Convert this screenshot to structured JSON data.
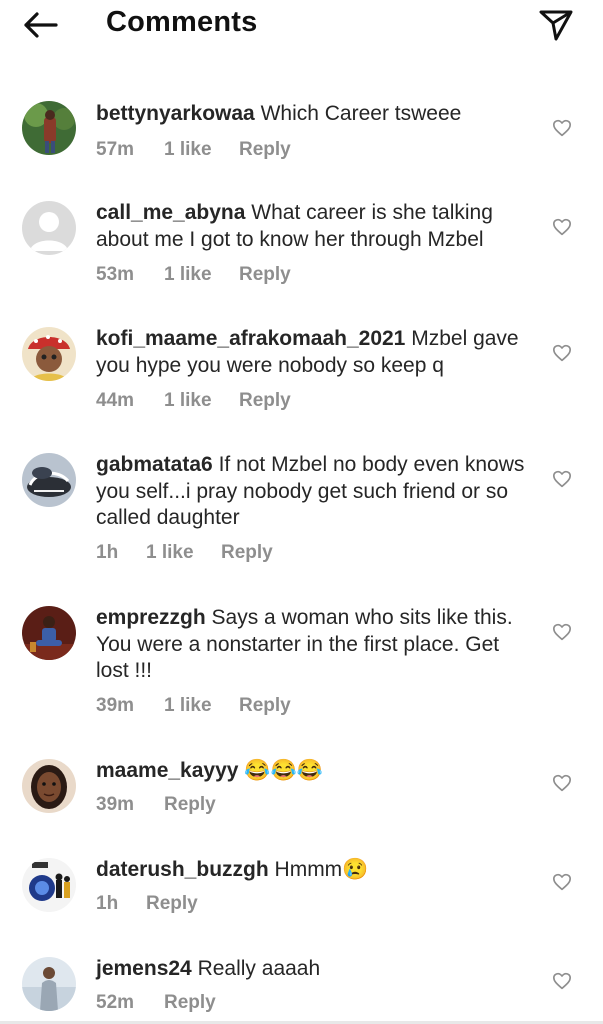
{
  "header": {
    "title": "Comments",
    "back_icon": "arrow-left-icon",
    "share_icon": "send-icon"
  },
  "comments": [
    {
      "user": "bettynyarkowaa",
      "text": "Which Career tsweee",
      "time": "57m",
      "likes": "1 like",
      "reply": "Reply"
    },
    {
      "user": "call_me_abyna",
      "text": "What career is she talking about me I got to know her through Mzbel",
      "time": "53m",
      "likes": "1 like",
      "reply": "Reply"
    },
    {
      "user": "kofi_maame_afrakomaah_2021",
      "text": "Mzbel gave you hype you were nobody so keep q",
      "time": "44m",
      "likes": "1 like",
      "reply": "Reply"
    },
    {
      "user": "gabmatata6",
      "text": "If not Mzbel no body even knows you self...i pray nobody get such friend or so called daughter",
      "time": "1h",
      "likes": "1 like",
      "reply": "Reply"
    },
    {
      "user": "emprezzgh",
      "text": "Says a woman who sits like this. You were a nonstarter in the first place. Get lost !!!",
      "time": "39m",
      "likes": "1 like",
      "reply": "Reply"
    },
    {
      "user": "maame_kayyy",
      "text": "😂😂😂",
      "time": "39m",
      "likes": "",
      "reply": "Reply"
    },
    {
      "user": "daterush_buzzgh",
      "text": "Hmmm😢",
      "time": "1h",
      "likes": "",
      "reply": "Reply"
    },
    {
      "user": "jemens24",
      "text": "Really aaaah",
      "time": "52m",
      "likes": "",
      "reply": "Reply"
    }
  ]
}
